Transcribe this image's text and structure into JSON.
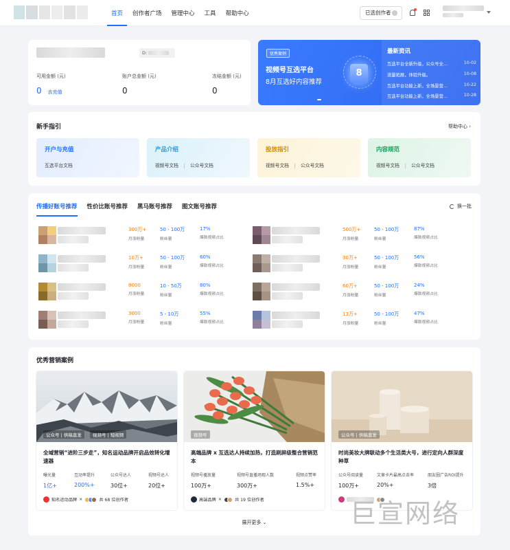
{
  "nav": {
    "items": [
      {
        "label": "首页",
        "active": true
      },
      {
        "label": "创作者广场",
        "active": false
      },
      {
        "label": "管理中心",
        "active": false
      },
      {
        "label": "工具",
        "active": false
      },
      {
        "label": "帮助中心",
        "active": false
      }
    ],
    "selected_creator": "已选创作者"
  },
  "account": {
    "id_label": "D:",
    "balances": [
      {
        "label": "可用金额 (元)",
        "value": "0",
        "link": "去充值"
      },
      {
        "label": "账户总金额 (元)",
        "value": "0"
      },
      {
        "label": "冻结金额 (元)",
        "value": "0"
      }
    ]
  },
  "banner": {
    "tag": "优秀案例",
    "line1": "视频号互选平台",
    "line2": "8月互选好内容推荐",
    "calendar_day": "8"
  },
  "news": {
    "title": "最新资讯",
    "items": [
      {
        "text": "互选平台全新升级，公众号全...",
        "date": "10-02"
      },
      {
        "text": "流量拓展，体验升级。",
        "date": "10-08"
      },
      {
        "text": "互选平台功能上新，全场景营...",
        "date": "10-22"
      },
      {
        "text": "互选平台功能上新，全场景营...",
        "date": "10-28"
      }
    ]
  },
  "guide": {
    "title": "新手指引",
    "help": "帮助中心 ›",
    "items": [
      {
        "title": "开户与充值",
        "docs": [
          "互选平台文档"
        ],
        "color": "#1f6fff"
      },
      {
        "title": "产品介绍",
        "docs": [
          "视频号文档",
          "公众号文档"
        ],
        "color": "#18a0d8"
      },
      {
        "title": "投放指引",
        "docs": [
          "视频号文档",
          "公众号文档"
        ],
        "color": "#d08a00"
      },
      {
        "title": "内容规范",
        "docs": [
          "视频号文档",
          "公众号文档"
        ],
        "color": "#15a05a"
      }
    ]
  },
  "recommend": {
    "tabs": [
      "传播好账号推荐",
      "性价比账号推荐",
      "黑马账号推荐",
      "图文账号推荐"
    ],
    "refresh": "换一批",
    "metric_labels": [
      "月涨粉量",
      "粉丝量",
      "爆款视频占比"
    ],
    "accounts": [
      {
        "growth": "300万+",
        "fans": "50 - 100万",
        "ratio": "17%"
      },
      {
        "growth": "500万+",
        "fans": "50 - 100万",
        "ratio": "87%"
      },
      {
        "growth": "10万+",
        "fans": "50 - 100万",
        "ratio": "60%"
      },
      {
        "growth": "30万+",
        "fans": "50 - 100万",
        "ratio": "56%"
      },
      {
        "growth": "8000",
        "fans": "10 - 50万",
        "ratio": "80%"
      },
      {
        "growth": "60万+",
        "fans": "50 - 100万",
        "ratio": "24%"
      },
      {
        "growth": "3000",
        "fans": "5 - 10万",
        "ratio": "55%"
      },
      {
        "growth": "13万+",
        "fans": "50 - 100万",
        "ratio": "47%"
      }
    ]
  },
  "cases": {
    "title": "优秀营销案例",
    "expand": "展开更多",
    "items": [
      {
        "tags": [
          "公众号 | 供稿直发",
          "视频号 | 短视频"
        ],
        "title": "全域营销“进阶三步走”，知名运动品牌开启品效转化增速器",
        "stats": [
          {
            "label": "曝光量",
            "value": "1亿+"
          },
          {
            "label": "互动率提升",
            "value": "200%+"
          },
          {
            "label": "公众号达人",
            "value": "30位+"
          },
          {
            "label": "视频号达人",
            "value": "20位+"
          }
        ],
        "brand": "知名运动品牌",
        "creators": "共 68 位创作者"
      },
      {
        "tags": [
          "视频号"
        ],
        "title": "高端品牌 x 互选达人持续加热，打造刷屏级整合营销范本",
        "stats": [
          {
            "label": "视频号播放量",
            "value": "100万+"
          },
          {
            "label": "视频号直播场观人数",
            "value": "300万+"
          },
          {
            "label": "视频点赞率",
            "value": "1.5%+"
          }
        ],
        "brand": "高端品牌",
        "creators": "共 19 位创作者"
      },
      {
        "tags": [
          "公众号 | 供稿直发"
        ],
        "title": "时尚美妆大牌联动多个生活类大号，进行定向人群深度种草",
        "stats": [
          {
            "label": "公众号阅读量",
            "value": "100万+"
          },
          {
            "label": "文章卡片最高点击率",
            "value": "20%+"
          },
          {
            "label": "朋友圈广告ROI提升",
            "value": "3倍"
          }
        ],
        "brand": "",
        "creators": ""
      }
    ]
  },
  "watermark": "巨宣网络"
}
